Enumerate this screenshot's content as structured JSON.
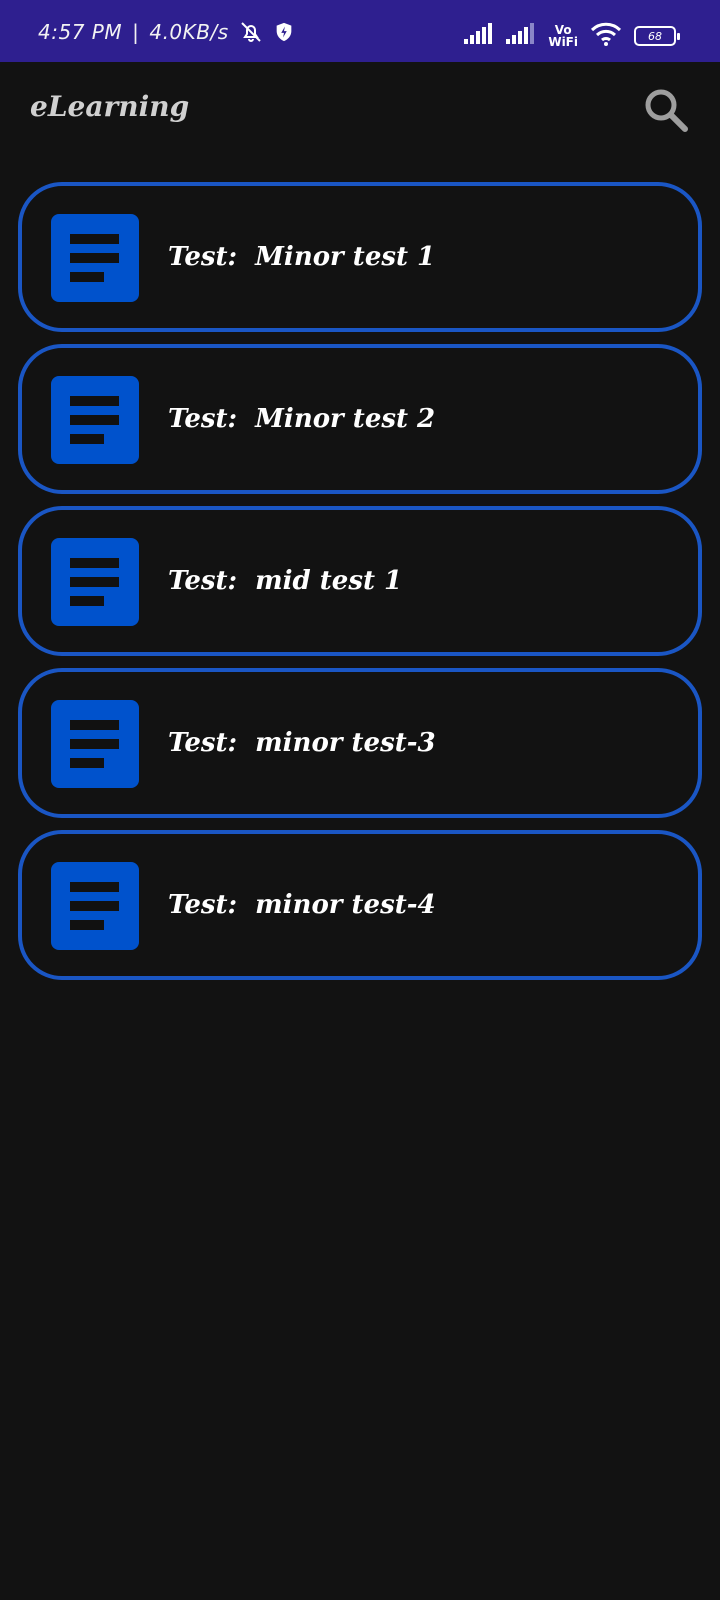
{
  "status_bar": {
    "time": "4:57 PM",
    "separator": "|",
    "speed": "4.0KB/s",
    "battery": "68",
    "vowifi_top": "Vo",
    "vowifi_bottom": "WiFi"
  },
  "app_bar": {
    "title": "eLearning",
    "search_icon": "search-icon"
  },
  "colors": {
    "status_bar": "#2e1f8f",
    "background": "#121212",
    "card_border": "#1a56c4",
    "icon_bg": "#0052cc"
  },
  "tests": [
    {
      "prefix": "Test:",
      "name": "Minor test 1"
    },
    {
      "prefix": "Test:",
      "name": "Minor test 2"
    },
    {
      "prefix": "Test:",
      "name": "mid test 1"
    },
    {
      "prefix": "Test:",
      "name": "minor test-3"
    },
    {
      "prefix": "Test:",
      "name": "minor test-4"
    }
  ]
}
